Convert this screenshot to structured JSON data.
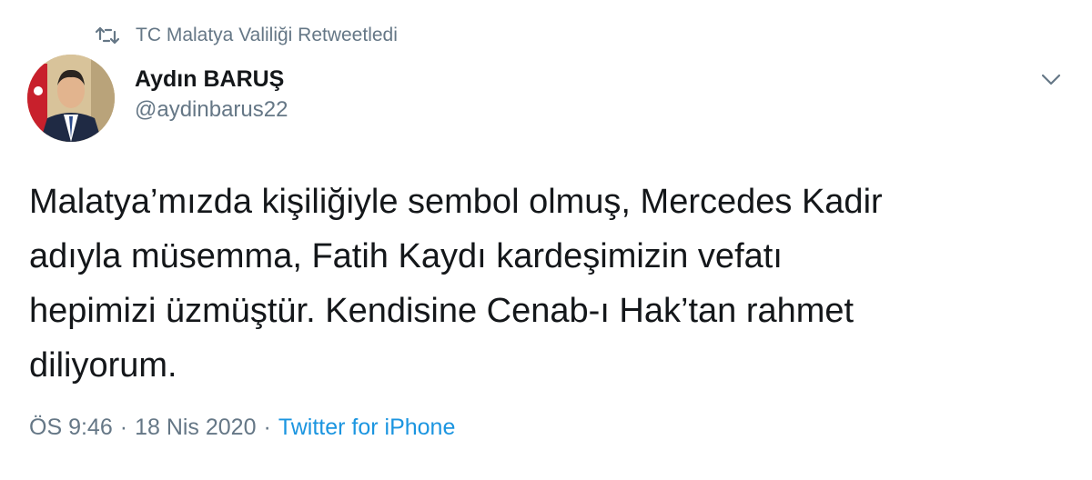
{
  "retweet": {
    "icon": "retweet-icon",
    "text": "TC Malatya Valiliği Retweetledi"
  },
  "author": {
    "avatar_icon": "avatar",
    "display_name": "Aydın BARUŞ",
    "handle": "@aydinbarus22"
  },
  "menu": {
    "icon": "chevron-down-icon"
  },
  "tweet": {
    "text": "Malatya’mızda kişiliğiyle sembol olmuş, Mercedes Kadir\nadıyla müsemma, Fatih Kaydı kardeşimizin vefatı\nhepimizi üzmüştür. Kendisine Cenab-ı Hak’tan rahmet\ndiliyorum."
  },
  "meta": {
    "time": "ÖS 9:46",
    "separator": "·",
    "date": "18 Nis 2020",
    "source": "Twitter for iPhone"
  },
  "colors": {
    "text_primary": "#14171a",
    "text_secondary": "#657786",
    "link": "#1b95e0"
  }
}
